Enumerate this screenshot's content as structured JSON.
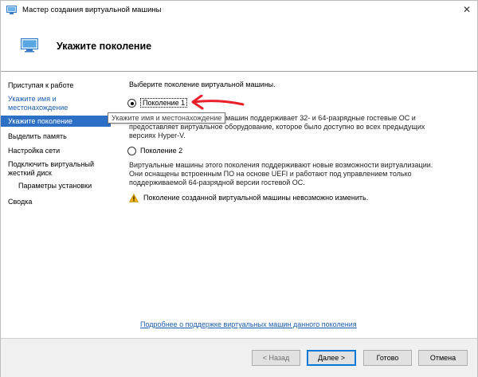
{
  "window": {
    "title": "Мастер создания виртуальной машины",
    "close_glyph": "✕"
  },
  "header": {
    "heading": "Укажите поколение"
  },
  "sidebar": {
    "items": [
      {
        "label": "Приступая к работе"
      },
      {
        "label": "Укажите имя и местонахождение"
      },
      {
        "label": "Укажите поколение"
      },
      {
        "label": "Выделить память"
      },
      {
        "label": "Настройка сети"
      },
      {
        "label": "Подключить виртуальный жесткий диск"
      },
      {
        "label": "Параметры установки"
      },
      {
        "label": "Сводка"
      }
    ]
  },
  "content": {
    "prompt": "Выберите поколение виртуальной машины.",
    "options": [
      {
        "label": "Поколение 1",
        "selected": true,
        "description_line1": "Это поколение виртуальных машин поддерживает 32- и 64-разрядные гостевые ОС и",
        "description_line2": "предоставляет виртуальное оборудование, которое было доступно во всех предыдущих",
        "description_line3": "версиях Hyper-V."
      },
      {
        "label": "Поколение 2",
        "selected": false,
        "description_line1": "Виртуальные машины этого поколения поддерживают новые возможности виртуализации.",
        "description_line2": "Они оснащены встроенным ПО на основе UEFI и работают под управлением только",
        "description_line3": "поддерживаемой 64-разрядной версии гостевой ОС."
      }
    ],
    "warning": "Поколение созданной виртуальной машины невозможно изменить.",
    "more_link": "Подробнее о поддержке виртуальных машин данного поколения"
  },
  "tooltip": "Укажите имя и местонахождение",
  "footer": {
    "back": "< Назад",
    "next": "Далее >",
    "finish": "Готово",
    "cancel": "Отмена"
  },
  "colors": {
    "accent": "#2d6fc4",
    "link": "#1a5fb4",
    "annotation_arrow": "#e8202a",
    "warning": "#f2b200"
  }
}
